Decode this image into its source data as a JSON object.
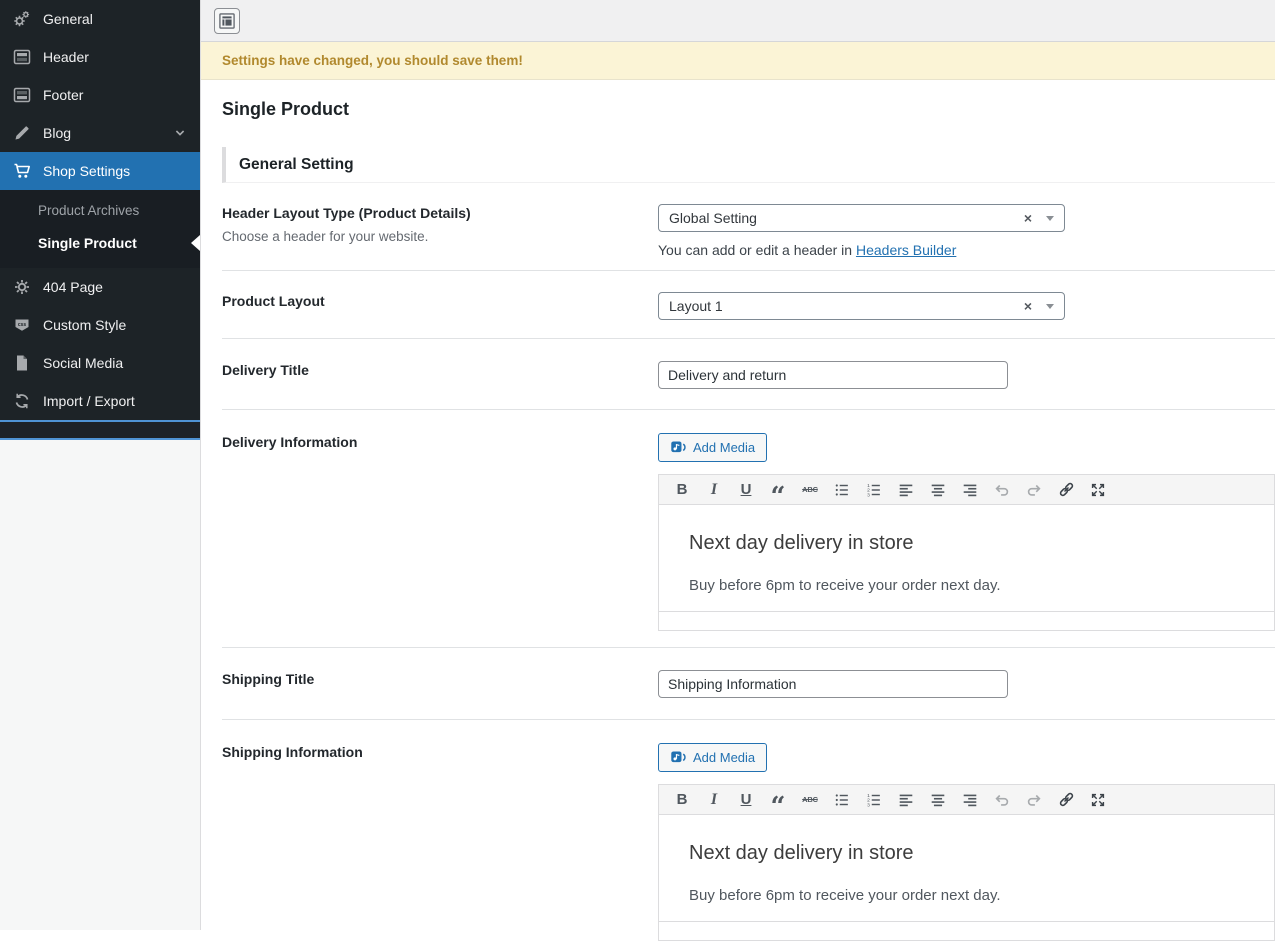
{
  "sidebar": {
    "items": [
      {
        "label": "General"
      },
      {
        "label": "Header"
      },
      {
        "label": "Footer"
      },
      {
        "label": "Blog"
      },
      {
        "label": "Shop Settings"
      },
      {
        "label": "404 Page"
      },
      {
        "label": "Custom Style"
      },
      {
        "label": "Social Media"
      },
      {
        "label": "Import / Export"
      }
    ],
    "submenu": [
      {
        "label": "Product Archives"
      },
      {
        "label": "Single Product"
      }
    ]
  },
  "notice": {
    "text": "Settings have changed, you should save them!"
  },
  "page": {
    "title": "Single Product",
    "section_title": "General Setting"
  },
  "rows": {
    "header_layout": {
      "label": "Header Layout Type (Product Details)",
      "description": "Choose a header for your website.",
      "value": "Global Setting",
      "help_prefix": "You can add or edit a header in ",
      "help_link_text": "Headers Builder"
    },
    "product_layout": {
      "label": "Product Layout",
      "value": "Layout 1"
    },
    "delivery_title": {
      "label": "Delivery Title",
      "value": "Delivery and return"
    },
    "delivery_information": {
      "label": "Delivery Information",
      "add_media_label": "Add Media",
      "content_heading": "Next day delivery in store",
      "content_paragraph": "Buy before 6pm to receive your order next day."
    },
    "shipping_title": {
      "label": "Shipping Title",
      "value": "Shipping Information"
    },
    "shipping_information": {
      "label": "Shipping Information",
      "add_media_label": "Add Media",
      "content_heading": "Next day delivery in store",
      "content_paragraph": "Buy before 6pm to receive your order next day."
    }
  },
  "editor": {
    "toolbar": [
      "bold",
      "italic",
      "underline",
      "blockquote",
      "strikethrough",
      "bullet-list",
      "numbered-list",
      "align-left",
      "align-center",
      "align-right",
      "undo",
      "redo",
      "link",
      "fullscreen"
    ]
  },
  "colors": {
    "accent": "#2271b1",
    "menu_bg": "#1d2327",
    "menu_active": "#2271b1",
    "notice_bg": "#fbf4d6",
    "notice_text": "#b1892e",
    "focus_outline": "#4f94d4"
  }
}
